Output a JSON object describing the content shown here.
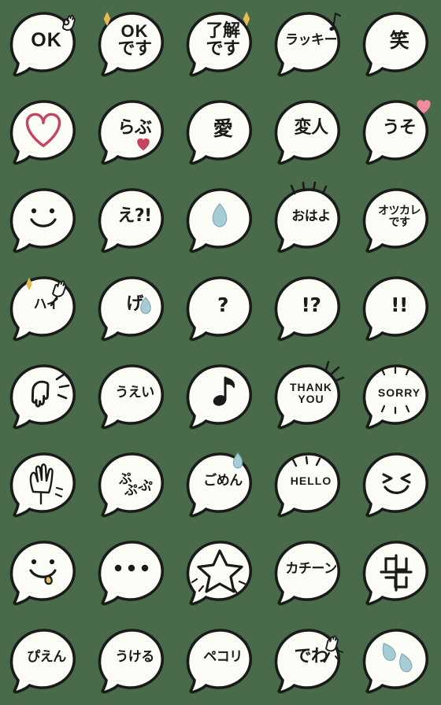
{
  "sheet": {
    "title": "Hand-drawn speech balloon emoji sticker sheet",
    "background_color": "#4a6b4a",
    "bubble_fill": "#fdfdf8",
    "bubble_stroke": "#1a1a1a",
    "ink_color": "#1a1a1a",
    "accent_colors": {
      "heart_red": "#c4455f",
      "heart_pink": "#f08aa0",
      "sparkle_gold": "#e3bc52",
      "drop_blue": "#a6ccd6"
    },
    "columns": 5,
    "rows": 8
  },
  "emoji": [
    {
      "id": "ok-hand",
      "text": "OK",
      "lines": [
        "OK"
      ],
      "size": "t-xl",
      "deco": "hand-ok",
      "note": "OK with ok-hand sign"
    },
    {
      "id": "ok-desu",
      "text": "OKです",
      "lines": [
        "OK",
        "です"
      ],
      "size": "t-lg",
      "deco": "sparkle-tl",
      "note": "OK desu with gold sparkle"
    },
    {
      "id": "ryoukai-desu",
      "text": "了解です",
      "lines": [
        "了解",
        "です"
      ],
      "size": "t-lg",
      "deco": "sparkle-tr",
      "note": "Ryoukai desu with gold sparkle"
    },
    {
      "id": "lucky",
      "text": "ラッキー",
      "lines": [
        "ラッキー"
      ],
      "size": "t-md",
      "deco": "note-tr",
      "note": "Lucky with music note antenna"
    },
    {
      "id": "warai",
      "text": "笑",
      "lines": [
        "笑"
      ],
      "size": "t-xl",
      "deco": "none",
      "note": "Laugh kanji"
    },
    {
      "id": "heart-big",
      "text": "",
      "lines": [],
      "size": "t-xl",
      "deco": "heart-big",
      "note": "Large outlined red heart"
    },
    {
      "id": "love",
      "text": "らぶ",
      "lines": [
        "らぶ"
      ],
      "size": "t-lg",
      "deco": "heart-sm-br",
      "note": "Rabu with small red heart"
    },
    {
      "id": "ai",
      "text": "愛",
      "lines": [
        "愛"
      ],
      "size": "t-xl",
      "deco": "none",
      "note": "Love kanji"
    },
    {
      "id": "henjin",
      "text": "変人",
      "lines": [
        "変人"
      ],
      "size": "t-lg",
      "deco": "none",
      "note": "Weirdo"
    },
    {
      "id": "uso",
      "text": "うそ",
      "lines": [
        "うそ"
      ],
      "size": "t-lg",
      "deco": "heart-pink-tr",
      "note": "No way with pink heart"
    },
    {
      "id": "smile",
      "text": "",
      "lines": [],
      "size": "t-xl",
      "deco": "face-smile",
      "note": "Smiley face"
    },
    {
      "id": "e-interro",
      "text": "え?!",
      "lines": [
        "え?!"
      ],
      "size": "t-lg",
      "deco": "none",
      "note": "Eh?!"
    },
    {
      "id": "teardrop",
      "text": "",
      "lines": [],
      "size": "t-xl",
      "deco": "drop-one",
      "note": "Single blue sweat drop"
    },
    {
      "id": "ohayo",
      "text": "おはよ",
      "lines": [
        "おはよ"
      ],
      "size": "t-md",
      "deco": "rays-top",
      "note": "Good morning with rays"
    },
    {
      "id": "otsukare-desu",
      "text": "オツカレです",
      "lines": [
        "オツカレ",
        "です"
      ],
      "size": "t-sm",
      "deco": "none",
      "note": "Otsukare desu"
    },
    {
      "id": "hai",
      "text": "ハイ",
      "lines": [
        "ハイ"
      ],
      "size": "t-md",
      "deco": "hand-wave-sparkle",
      "note": "Hai with waving hand and sparkle"
    },
    {
      "id": "ge",
      "text": "げ",
      "lines": [
        "げ"
      ],
      "size": "t-lg",
      "deco": "drop-right",
      "note": "Ge with sweat drop"
    },
    {
      "id": "question",
      "text": "?",
      "lines": [
        "?"
      ],
      "size": "t-xl",
      "deco": "none",
      "note": "Question mark"
    },
    {
      "id": "interrobang",
      "text": "!?",
      "lines": [
        "!?"
      ],
      "size": "t-xl",
      "deco": "none",
      "note": "Interrobang"
    },
    {
      "id": "double-bang",
      "text": "!!",
      "lines": [
        "!!"
      ],
      "size": "t-xl",
      "deco": "none",
      "note": "Double exclamation"
    },
    {
      "id": "thumbs-up",
      "text": "",
      "lines": [],
      "size": "t-xl",
      "deco": "thumb-up",
      "note": "Thumbs up with shine lines"
    },
    {
      "id": "uei",
      "text": "うえい",
      "lines": [
        "うえい"
      ],
      "size": "t-md",
      "deco": "none",
      "note": "Uei"
    },
    {
      "id": "music-note",
      "text": "",
      "lines": [],
      "size": "t-xl",
      "deco": "music-note",
      "note": "Eighth note"
    },
    {
      "id": "thank-you",
      "text": "THANK YOU",
      "lines": [
        "THANK",
        "YOU"
      ],
      "size": "t-sm",
      "deco": "rays-tr",
      "note": "Thank you with shine"
    },
    {
      "id": "sorry",
      "text": "SORRY",
      "lines": [
        "SORRY"
      ],
      "size": "t-sm",
      "deco": "dashes-updown",
      "note": "Sorry with dashes"
    },
    {
      "id": "raised-hand",
      "text": "",
      "lines": [],
      "size": "t-xl",
      "deco": "hand-raise",
      "note": "Raised hand with motion lines"
    },
    {
      "id": "pupupu",
      "text": "ぷぷぷ",
      "lines": [
        "ぷぷぷ"
      ],
      "size": "t-md",
      "deco": "scatter",
      "note": "Pupupu scattered"
    },
    {
      "id": "gomen",
      "text": "ごめん",
      "lines": [
        "ごめん"
      ],
      "size": "t-md",
      "deco": "drop-top",
      "note": "Gomen with sweat drop"
    },
    {
      "id": "hello",
      "text": "HELLO",
      "lines": [
        "HELLO"
      ],
      "size": "t-sm",
      "deco": "dashes-top",
      "note": "Hello with shine"
    },
    {
      "id": "grin-squint",
      "text": "",
      "lines": [],
      "size": "t-xl",
      "deco": "face-squint",
      "note": "Squinting smiley face"
    },
    {
      "id": "tongue-out",
      "text": "",
      "lines": [],
      "size": "t-xl",
      "deco": "face-tongue",
      "note": "Smiley sticking tongue out"
    },
    {
      "id": "dots",
      "text": "・・・",
      "lines": [],
      "size": "t-xl",
      "deco": "three-dots",
      "note": "Three dots / silence"
    },
    {
      "id": "star",
      "text": "",
      "lines": [],
      "size": "t-xl",
      "deco": "star",
      "note": "Outlined star with shine"
    },
    {
      "id": "kachiin",
      "text": "カチーン",
      "lines": [
        "カチーン"
      ],
      "size": "t-md",
      "deco": "none",
      "note": "Kachiin (irritated)"
    },
    {
      "id": "anger-mark",
      "text": "",
      "lines": [],
      "size": "t-xl",
      "deco": "anger",
      "note": "Anger vein mark"
    },
    {
      "id": "pien",
      "text": "ぴえん",
      "lines": [
        "ぴえん"
      ],
      "size": "t-md",
      "deco": "none",
      "note": "Pien (teary)"
    },
    {
      "id": "ukeru",
      "text": "うける",
      "lines": [
        "うける"
      ],
      "size": "t-md",
      "deco": "none",
      "note": "Ukeru (hilarious)"
    },
    {
      "id": "pekori",
      "text": "ペコリ",
      "lines": [
        "ペコリ"
      ],
      "size": "t-md",
      "deco": "none",
      "note": "Pekori (bow)"
    },
    {
      "id": "dewa",
      "text": "でわ",
      "lines": [
        "でわ"
      ],
      "size": "t-lg",
      "deco": "hand-bye",
      "note": "Dewa with waving hand"
    },
    {
      "id": "two-drops",
      "text": "",
      "lines": [],
      "size": "t-xl",
      "deco": "drop-two",
      "note": "Two blue tear drops"
    }
  ]
}
